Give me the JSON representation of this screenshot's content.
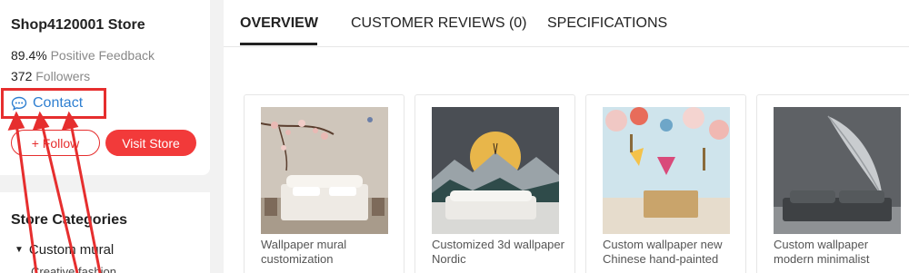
{
  "store": {
    "name": "Shop4120001 Store",
    "feedback_value": "89.4%",
    "feedback_label": "Positive Feedback",
    "followers_value": "372",
    "followers_label": "Followers",
    "contact_label": "Contact",
    "follow_label": "+ Follow",
    "visit_label": "Visit Store"
  },
  "categories": {
    "title": "Store Categories",
    "item": "Custom mural",
    "sub_item": "Creative fashion"
  },
  "tabs": [
    {
      "label": "OVERVIEW",
      "active": true
    },
    {
      "label": "CUSTOMER REVIEWS (0)",
      "active": false
    },
    {
      "label": "SPECIFICATIONS",
      "active": false
    }
  ],
  "products": [
    {
      "title": "Wallpaper mural customization"
    },
    {
      "title": "Customized 3d wallpaper Nordic"
    },
    {
      "title": "Custom wallpaper new Chinese hand-painted"
    },
    {
      "title": "Custom wallpaper modern minimalist"
    }
  ],
  "colors": {
    "accent_red": "#f23a3a",
    "link_blue": "#2e7fd1",
    "annotation_red": "#e62e2e"
  },
  "icons": {
    "contact": "chat-bubble-icon",
    "category_toggle": "caret-down-icon"
  }
}
